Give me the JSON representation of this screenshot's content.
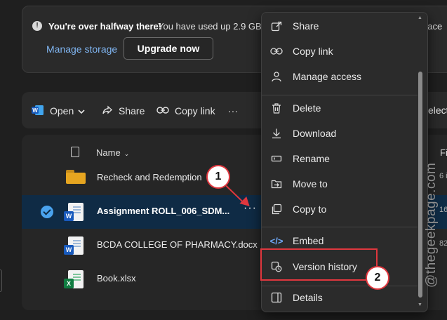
{
  "banner": {
    "title": "You're over halfway there!",
    "message": "You have used up 2.9 GB. U",
    "message_tail": "pace",
    "manage_link": "Manage storage",
    "upgrade_button": "Upgrade now"
  },
  "toolbar": {
    "open": "Open",
    "share": "Share",
    "copy_link": "Copy link",
    "more": "···",
    "select_partial": "elect"
  },
  "list": {
    "header_name": "Name",
    "header_file_size_partial": "Fil",
    "rows": [
      {
        "name": "Recheck and Redemption",
        "size": "6 i",
        "type": "folder"
      },
      {
        "name": "Assignment ROLL_006_SDM...",
        "size": "16",
        "type": "word",
        "selected": true
      },
      {
        "name": "BCDA COLLEGE OF PHARMACY.docx",
        "size": "82",
        "type": "word"
      },
      {
        "name": "Book.xlsx",
        "size": "",
        "type": "excel"
      }
    ]
  },
  "context_menu": {
    "items": [
      "Share",
      "Copy link",
      "Manage access",
      "Delete",
      "Download",
      "Rename",
      "Move to",
      "Copy to",
      "Embed",
      "Version history",
      "Details"
    ]
  },
  "annotations": {
    "callout_1": "1",
    "callout_2": "2",
    "highlight_color": "#e0373e"
  },
  "watermark": "@thegeekpage.com",
  "colors": {
    "selected_row": "#0f2b45",
    "link": "#7fb4f0",
    "check": "#4aa3ee",
    "word": "#185abd",
    "excel": "#107c41",
    "folder": "#e6a520"
  }
}
